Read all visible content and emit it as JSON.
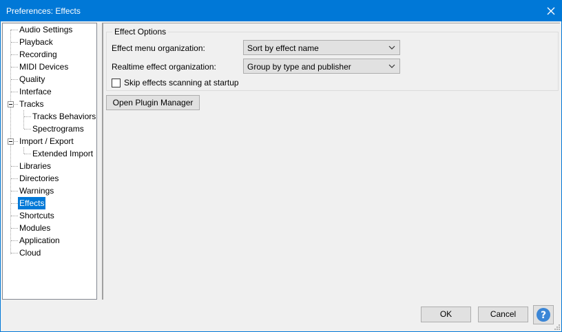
{
  "window": {
    "title": "Preferences: Effects"
  },
  "tree": {
    "items": [
      {
        "label": "Audio Settings"
      },
      {
        "label": "Playback"
      },
      {
        "label": "Recording"
      },
      {
        "label": "MIDI Devices"
      },
      {
        "label": "Quality"
      },
      {
        "label": "Interface"
      },
      {
        "label": "Tracks"
      },
      {
        "label": "Tracks Behaviors"
      },
      {
        "label": "Spectrograms"
      },
      {
        "label": "Import / Export"
      },
      {
        "label": "Extended Import"
      },
      {
        "label": "Libraries"
      },
      {
        "label": "Directories"
      },
      {
        "label": "Warnings"
      },
      {
        "label": "Effects"
      },
      {
        "label": "Shortcuts"
      },
      {
        "label": "Modules"
      },
      {
        "label": "Application"
      },
      {
        "label": "Cloud"
      }
    ],
    "selected": "Effects"
  },
  "effect_options": {
    "group_title": "Effect Options",
    "menu_org_label": "Effect menu organization:",
    "menu_org_value": "Sort by effect name",
    "realtime_org_label": "Realtime effect organization:",
    "realtime_org_value": "Group by type and publisher",
    "skip_scan_label": "Skip effects scanning at startup",
    "skip_scan_checked": false
  },
  "buttons": {
    "plugin_manager": "Open Plugin Manager",
    "ok": "OK",
    "cancel": "Cancel",
    "help": "?"
  },
  "colors": {
    "accent": "#0078d7",
    "selection": "#0078d7",
    "help_icon": "#3b86d6"
  }
}
